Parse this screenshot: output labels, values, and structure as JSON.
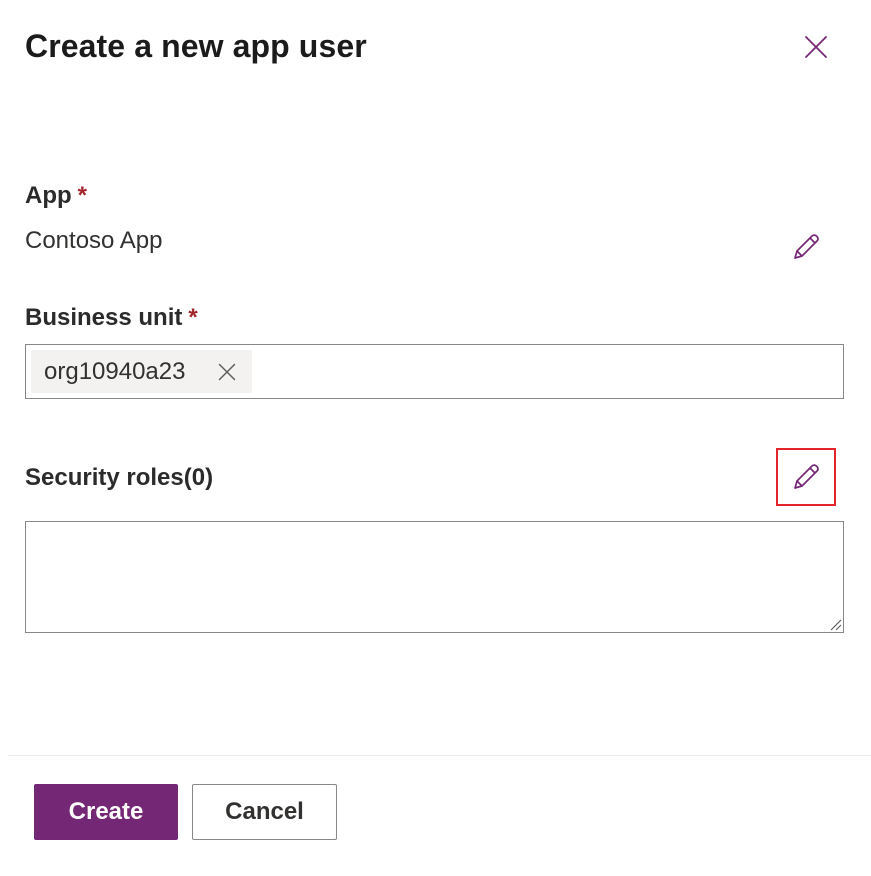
{
  "dialog": {
    "title": "Create a new app user"
  },
  "fields": {
    "app": {
      "label": "App",
      "required_marker": "*",
      "value": "Contoso App"
    },
    "business_unit": {
      "label": "Business unit",
      "required_marker": "*",
      "chips": [
        "org10940a23"
      ]
    },
    "security_roles": {
      "label": "Security roles(0)",
      "value": ""
    }
  },
  "footer": {
    "create_label": "Create",
    "cancel_label": "Cancel"
  },
  "icons": {
    "close": "close-icon",
    "edit": "pencil-icon",
    "chip_remove": "dismiss-icon"
  },
  "colors": {
    "brand_purple": "#742774",
    "required_red": "#a4262c",
    "highlight_red": "#e3262c",
    "border_gray": "#8a8886",
    "chip_bg": "#f3f2f1"
  }
}
